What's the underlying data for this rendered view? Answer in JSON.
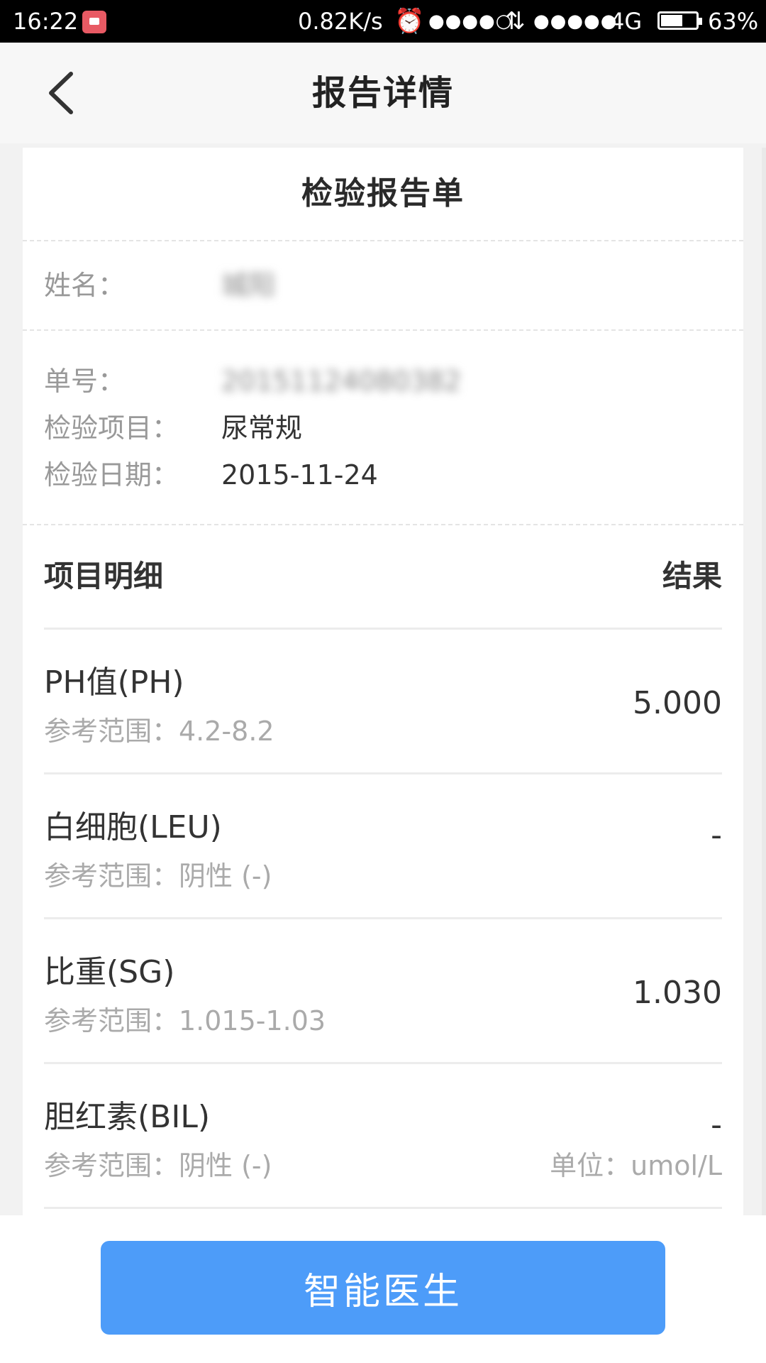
{
  "status_bar": {
    "time": "16:22",
    "net_speed": "0.82K/s",
    "signal1": "●●●●○",
    "signal2": "●●●●●",
    "network": "4G",
    "battery_percent": "63%",
    "battery_level": 0.63
  },
  "header": {
    "title": "报告详情"
  },
  "report": {
    "title": "检验报告单",
    "name_label": "姓名：",
    "name_value": "城阳",
    "number_label": "单号：",
    "number_value": "20151124080382",
    "item_label": "检验项目：",
    "item_value": "尿常规",
    "date_label": "检验日期：",
    "date_value": "2015-11-24"
  },
  "table": {
    "col_item": "项目明细",
    "col_result": "结果",
    "rows": [
      {
        "name": "PH值(PH)",
        "ref": "参考范围：4.2-8.2",
        "result": "5.000",
        "unit": ""
      },
      {
        "name": "白细胞(LEU)",
        "ref": "参考范围：阴性 (-)",
        "result": "-",
        "unit": ""
      },
      {
        "name": "比重(SG)",
        "ref": "参考范围：1.015-1.03",
        "result": "1.030",
        "unit": ""
      },
      {
        "name": "胆红素(BIL)",
        "ref": "参考范围：阴性 (-)",
        "result": "-",
        "unit": "单位：umol/L"
      }
    ]
  },
  "footer": {
    "button_label": "智能医生"
  },
  "colors": {
    "primary_button": "#4d9cf9",
    "status_bar": "#000000"
  }
}
